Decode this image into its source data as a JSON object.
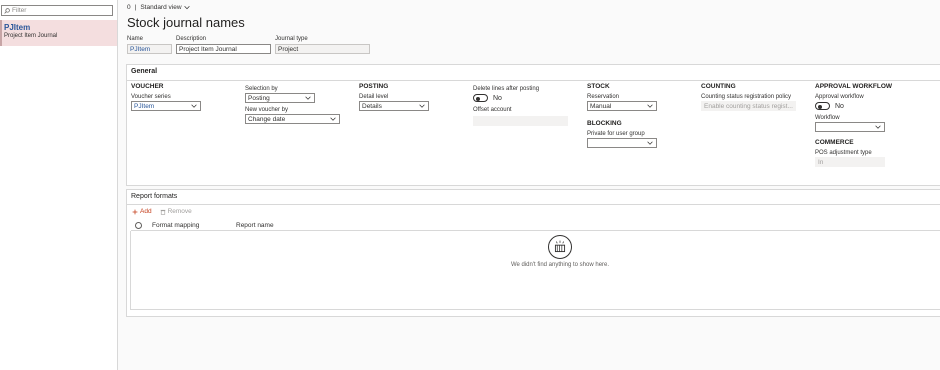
{
  "left_pane": {
    "filter_placeholder": "Filter",
    "items": [
      {
        "title": "PJItem",
        "subtitle": "Project Item Journal"
      }
    ]
  },
  "topbar": {
    "count": "0",
    "separator": "|",
    "view_label": "Standard view"
  },
  "page_title": "Stock journal names",
  "header": {
    "name_label": "Name",
    "name_value": "PJItem",
    "description_label": "Description",
    "description_value": "Project Item Journal",
    "journal_type_label": "Journal type",
    "journal_type_value": "Project"
  },
  "general": {
    "title": "General",
    "voucher": {
      "head": "VOUCHER",
      "series_label": "Voucher series",
      "series_value": "PJItem"
    },
    "selection": {
      "label": "Selection by",
      "value": "Posting",
      "new_voucher_label": "New voucher by",
      "new_voucher_value": "Change date"
    },
    "posting": {
      "head": "POSTING",
      "detail_label": "Detail level",
      "detail_value": "Details"
    },
    "delete_lines": {
      "label": "Delete lines after posting",
      "toggle_value": "No",
      "offset_label": "Offset account",
      "offset_value": ""
    },
    "stock": {
      "head": "STOCK",
      "reservation_label": "Reservation",
      "reservation_value": "Manual",
      "blocking_head": "BLOCKING",
      "private_label": "Private for user group",
      "private_value": ""
    },
    "counting": {
      "head": "COUNTING",
      "policy_label": "Counting status registration policy",
      "policy_value": "Enable counting status regist..."
    },
    "approval": {
      "head": "APPROVAL WORKFLOW",
      "approval_label": "Approval workflow",
      "toggle_value": "No",
      "workflow_label": "Workflow",
      "workflow_value": "",
      "commerce_head": "COMMERCE",
      "pos_label": "POS adjustment type",
      "pos_value": "In"
    }
  },
  "report_formats": {
    "title": "Report formats",
    "add_label": "Add",
    "remove_label": "Remove",
    "columns": [
      "Format mapping",
      "Report name"
    ],
    "empty_message": "We didn't find anything to show here."
  },
  "colors": {
    "accent": "#2b579a",
    "selected_bg": "#f4dedf",
    "add_red": "#c43e1c"
  }
}
